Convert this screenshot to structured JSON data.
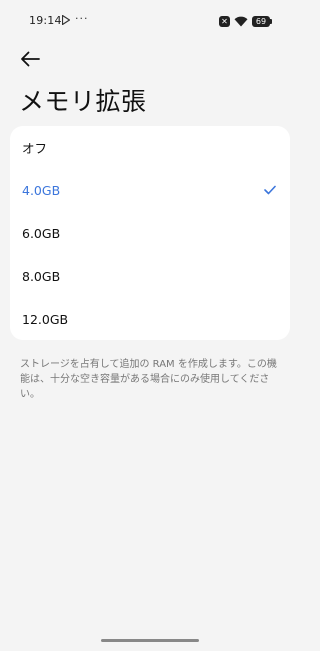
{
  "status_bar": {
    "time": "19:14",
    "more": "···",
    "battery": "69",
    "sim_badge": "✕"
  },
  "header": {
    "title": "メモリ拡張"
  },
  "options": [
    {
      "label": "オフ",
      "selected": false
    },
    {
      "label": "4.0GB",
      "selected": true
    },
    {
      "label": "6.0GB",
      "selected": false
    },
    {
      "label": "8.0GB",
      "selected": false
    },
    {
      "label": "12.0GB",
      "selected": false
    }
  ],
  "note": "ストレージを占有して追加の RAM を作成します。この機能は、十分な空き容量がある場合にのみ使用してください。",
  "colors": {
    "accent": "#3c76dc",
    "background": "#f4f4f4",
    "card": "#ffffff"
  },
  "icons": {
    "back": "arrow-left-icon",
    "check": "check-icon",
    "wifi": "wifi-icon",
    "battery": "battery-icon"
  }
}
